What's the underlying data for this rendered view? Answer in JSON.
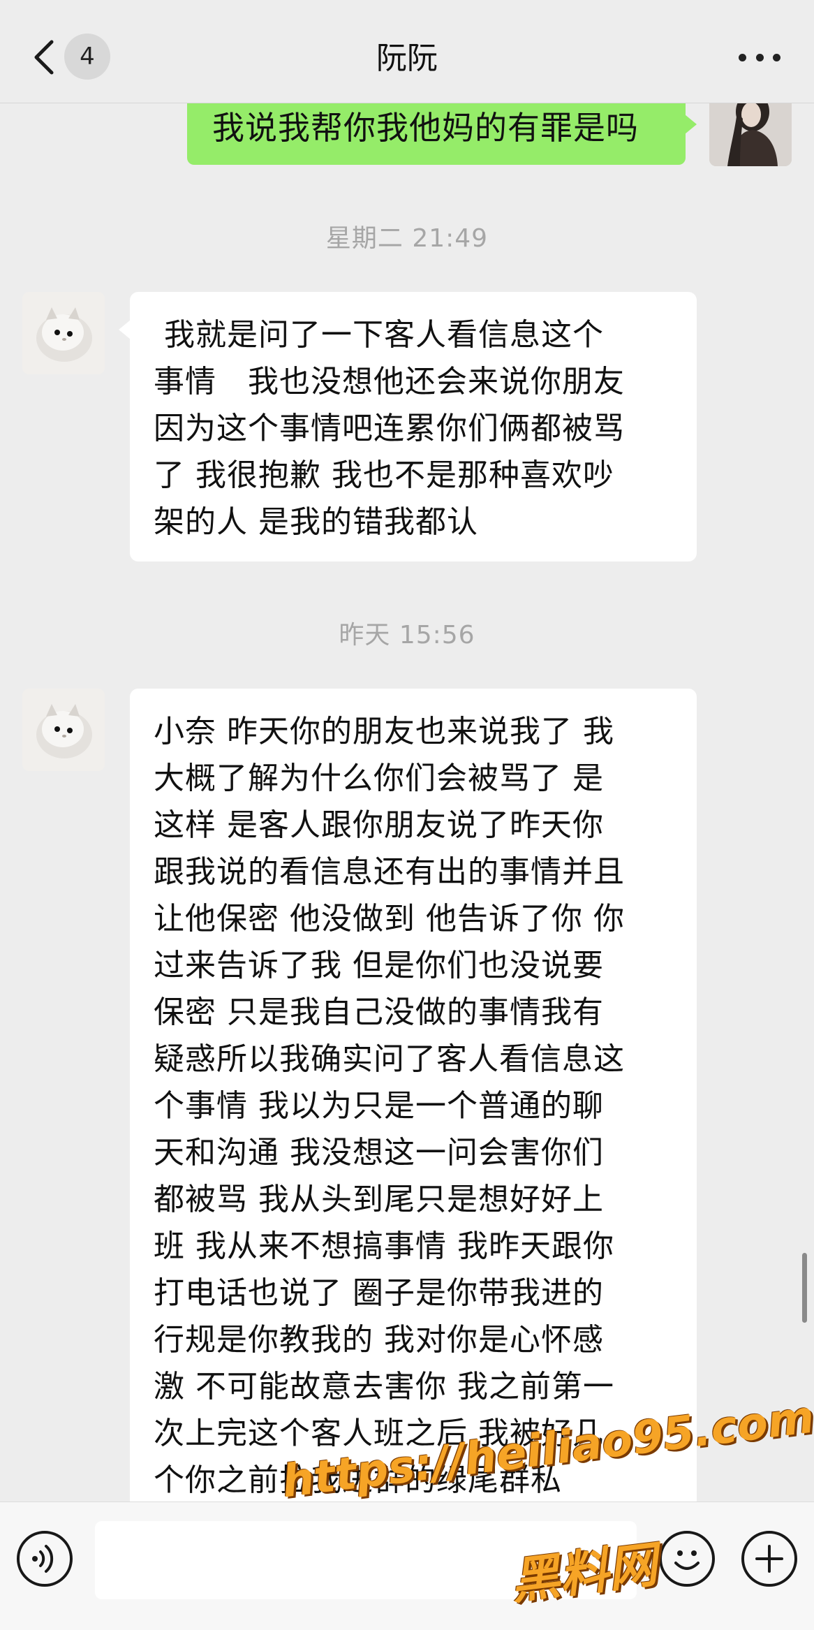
{
  "header": {
    "back_label": "返回",
    "unread_count": "4",
    "title": "阮阮"
  },
  "messages": {
    "self_message": "我说我帮你我他妈的有罪是吗",
    "timestamp_1": "星期二 21:49",
    "other_message_1": " 我就是问了一下客人看信息这个\n事情   我也没想他还会来说你朋友\n因为这个事情吧连累你们俩都被骂\n了 我很抱歉 我也不是那种喜欢吵\n架的人 是我的错我都认",
    "timestamp_2": "昨天 15:56",
    "other_message_2": "小奈 昨天你的朋友也来说我了 我\n大概了解为什么你们会被骂了 是\n这样 是客人跟你朋友说了昨天你\n跟我说的看信息还有出的事情并且\n让他保密 他没做到 他告诉了你 你\n过来告诉了我 但是你们也没说要\n保密 只是我自己没做的事情我有\n疑惑所以我确实问了客人看信息这\n个事情 我以为只是一个普通的聊\n天和沟通 我没想这一问会害你们\n都被骂 我从头到尾只是想好好上\n班 我从来不想搞事情 我昨天跟你\n打电话也说了 圈子是你带我进的\n行规是你教我的 我对你是心怀感\n激 不可能故意去害你 我之前第一\n次上完这个客人班之后 我被好几\n个你之前拉我进群的绿尾群私"
  },
  "input_bar": {
    "placeholder": ""
  },
  "watermark": {
    "url": "https://heiliao95.com",
    "name": "黑料网"
  },
  "icons": {
    "back": "chevron-left-icon",
    "more": "more-dots-icon",
    "voice": "voice-icon",
    "emoji": "emoji-icon",
    "plus": "plus-icon"
  },
  "colors": {
    "self_bubble": "#95ec69",
    "other_bubble": "#ffffff",
    "background": "#ededed",
    "watermark": "#f6a426"
  }
}
